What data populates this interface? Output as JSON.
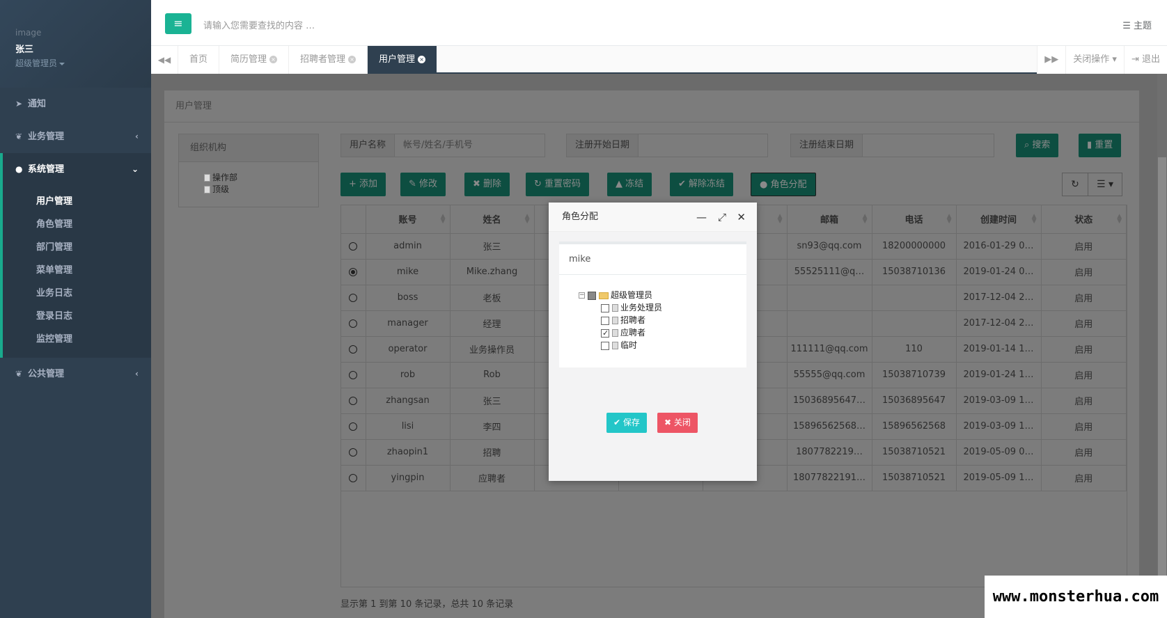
{
  "sidebar": {
    "image_alt": "image",
    "user_name": "张三",
    "user_role": "超级管理员",
    "nav": [
      {
        "label": "通知",
        "icon": "paper-plane-icon"
      },
      {
        "label": "业务管理",
        "icon": "leaf-icon"
      },
      {
        "label": "系统管理",
        "icon": "user-icon"
      }
    ],
    "subnav": [
      "用户管理",
      "角色管理",
      "部门管理",
      "菜单管理",
      "业务日志",
      "登录日志",
      "监控管理"
    ],
    "nav_bottom": {
      "label": "公共管理",
      "icon": "leaf-icon"
    }
  },
  "topbar": {
    "search_placeholder": "请输入您需要查找的内容 …",
    "theme_label": "主题"
  },
  "tabs": [
    {
      "label": "首页"
    },
    {
      "label": "简历管理"
    },
    {
      "label": "招聘者管理"
    },
    {
      "label": "用户管理"
    }
  ],
  "tab_right": {
    "close_ops": "关闭操作",
    "logout": "退出"
  },
  "panel": {
    "title": "用户管理",
    "org_title": "组织机构",
    "org_items": [
      "操作部",
      "顶级"
    ]
  },
  "filters": {
    "username_label": "用户名称",
    "username_placeholder": "帐号/姓名/手机号",
    "start_label": "注册开始日期",
    "end_label": "注册结束日期",
    "search_btn": "搜索",
    "reset_btn": "重置"
  },
  "actions": {
    "add": "添加",
    "edit": "修改",
    "delete": "删除",
    "reset_pwd": "重置密码",
    "freeze": "冻结",
    "unfreeze": "解除冻结",
    "assign_role": "角色分配"
  },
  "table": {
    "headers": [
      "账号",
      "姓名",
      "",
      "",
      "",
      "邮箱",
      "电话",
      "创建时间",
      "状态"
    ],
    "rows": [
      {
        "account": "admin",
        "name": "张三",
        "email": "sn93@qq.com",
        "phone": "18200000000",
        "created": "2016-01-29 0…",
        "status": "启用",
        "selected": false
      },
      {
        "account": "mike",
        "name": "Mike.zhang",
        "email": "55525111@q…",
        "phone": "15038710136",
        "created": "2019-01-24 0…",
        "status": "启用",
        "selected": true
      },
      {
        "account": "boss",
        "name": "老板",
        "email": "",
        "phone": "",
        "created": "2017-12-04 2…",
        "status": "启用",
        "selected": false
      },
      {
        "account": "manager",
        "name": "经理",
        "email": "",
        "phone": "",
        "created": "2017-12-04 2…",
        "status": "启用",
        "selected": false
      },
      {
        "account": "operator",
        "name": "业务操作员",
        "email": "111111@qq.com",
        "phone": "110",
        "created": "2019-01-14 1…",
        "status": "启用",
        "selected": false
      },
      {
        "account": "rob",
        "name": "Rob",
        "email": "55555@qq.com",
        "phone": "15038710739",
        "created": "2019-01-24 1…",
        "status": "启用",
        "selected": false
      },
      {
        "account": "zhangsan",
        "name": "张三",
        "email": "15036895647…",
        "phone": "15036895647",
        "created": "2019-03-09 1…",
        "status": "启用",
        "selected": false
      },
      {
        "account": "lisi",
        "name": "李四",
        "email": "15896562568…",
        "phone": "15896562568",
        "created": "2019-03-09 1…",
        "status": "启用",
        "selected": false
      },
      {
        "account": "zhaopin1",
        "name": "招聘",
        "email": "1807782219…",
        "phone": "15038710521",
        "created": "2019-05-09 0…",
        "status": "启用",
        "selected": false
      },
      {
        "account": "yingpin",
        "name": "应聘者",
        "email": "18077822191…",
        "phone": "15038710521",
        "created": "2019-05-09 1…",
        "status": "启用",
        "selected": false
      }
    ]
  },
  "footer_info": "显示第 1 到第 10 条记录，总共 10 条记录",
  "modal": {
    "title": "角色分配",
    "user": "mike",
    "tree_root": "超级管理员",
    "tree_children": [
      {
        "label": "业务处理员",
        "checked": false
      },
      {
        "label": "招聘者",
        "checked": false
      },
      {
        "label": "应聘者",
        "checked": true
      },
      {
        "label": "临时",
        "checked": false
      }
    ],
    "save": "保存",
    "close": "关闭"
  },
  "watermark": "www.monsterhua.com"
}
